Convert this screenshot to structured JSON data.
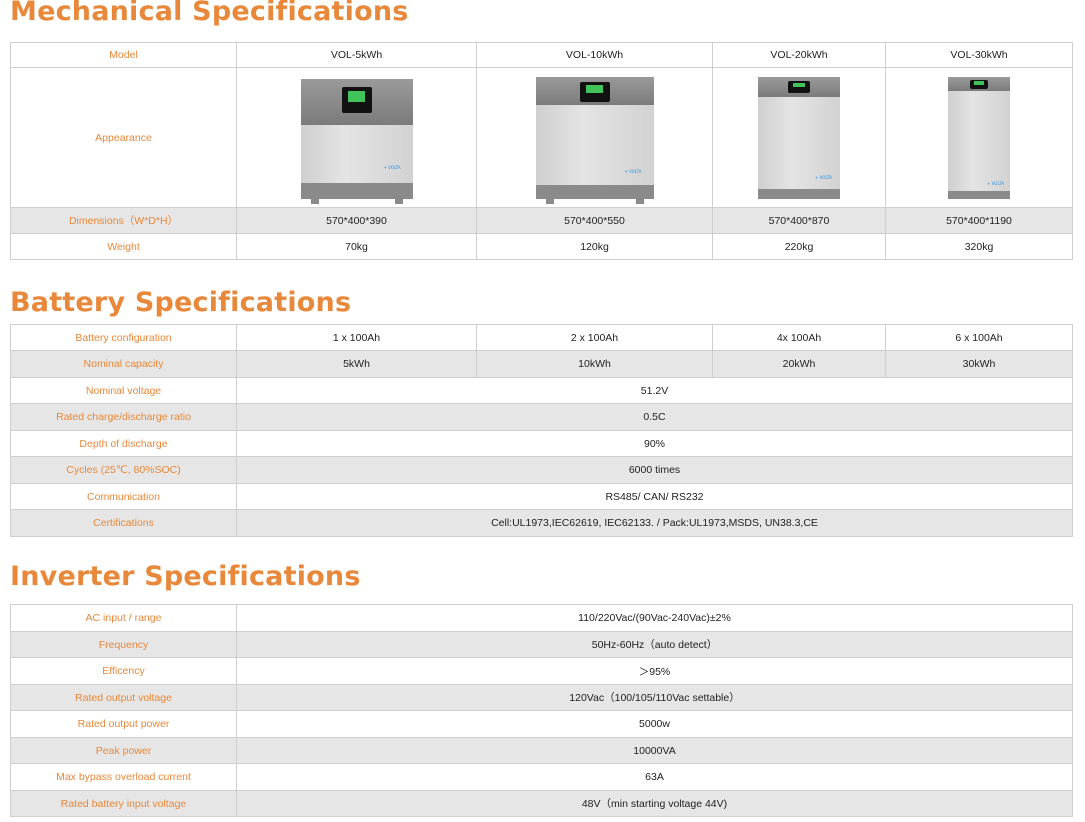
{
  "mechanical": {
    "title": "Mechanical Specifications",
    "header": [
      "Model",
      "VOL-5kWh",
      "VOL-10kWh",
      "VOL-20kWh",
      "VOL-30kWh"
    ],
    "appearance_label": "Appearance",
    "products": [
      {
        "name": "VOL-5kWh-unit-image",
        "logo": "+ VOLTA"
      },
      {
        "name": "VOL-10kWh-unit-image",
        "logo": "+ VOLTA"
      },
      {
        "name": "VOL-20kWh-unit-image",
        "logo": "+ VOLTA"
      },
      {
        "name": "VOL-30kWh-unit-image",
        "logo": "+ VOLTA"
      }
    ],
    "rows": [
      {
        "label": "Dimensions（W*D*H）",
        "values": [
          "570*400*390",
          "570*400*550",
          "570*400*870",
          "570*400*1190"
        ]
      },
      {
        "label": "Weight",
        "values": [
          "70kg",
          "120kg",
          "220kg",
          "320kg"
        ]
      }
    ]
  },
  "battery": {
    "title": "Battery Specifications",
    "rows": [
      {
        "label": "Battery configuration",
        "values": [
          "1 x 100Ah",
          "2 x 100Ah",
          "4x 100Ah",
          "6 x 100Ah"
        ]
      },
      {
        "label": "Nominal capacity",
        "values": [
          "5kWh",
          "10kWh",
          "20kWh",
          "30kWh"
        ]
      },
      {
        "label": "Nominal voltage",
        "values": [
          "51.2V"
        ]
      },
      {
        "label": "Rated charge/discharge ratio",
        "values": [
          "0.5C"
        ]
      },
      {
        "label": "Depth of discharge",
        "values": [
          "90%"
        ]
      },
      {
        "label": "Cycles (25℃, 80%SOC)",
        "values": [
          "6000 times"
        ]
      },
      {
        "label": "Communication",
        "values": [
          "RS485/ CAN/ RS232"
        ]
      },
      {
        "label": "Certifications",
        "values": [
          "Cell:UL1973,IEC62619, IEC62133. /   Pack:UL1973,MSDS, UN38.3,CE"
        ]
      }
    ]
  },
  "inverter": {
    "title": "Inverter Specifications",
    "rows": [
      {
        "label": "AC input / range",
        "values": [
          "110/220Vac/(90Vac-240Vac)±2%"
        ]
      },
      {
        "label": "Frequency",
        "values": [
          "50Hz-60Hz（auto detect）"
        ]
      },
      {
        "label": "Efficency",
        "values": [
          "＞95%"
        ]
      },
      {
        "label": "Rated output voltage",
        "values": [
          "120Vac（100/105/110Vac settable）"
        ]
      },
      {
        "label": "Rated output power",
        "values": [
          "5000w"
        ]
      },
      {
        "label": "Peak power",
        "values": [
          "10000VA"
        ]
      },
      {
        "label": "Max bypass overload current",
        "values": [
          "63A"
        ]
      },
      {
        "label": "Rated battery input voltage",
        "values": [
          "48V（min starting voltage 44V)"
        ]
      }
    ]
  },
  "colors": {
    "accent": "#e8883a",
    "row_grey": "#e6e6e6",
    "border": "#cfcfcf",
    "screen_green": "#3fc35a",
    "logo_blue": "#2a8ed8"
  }
}
